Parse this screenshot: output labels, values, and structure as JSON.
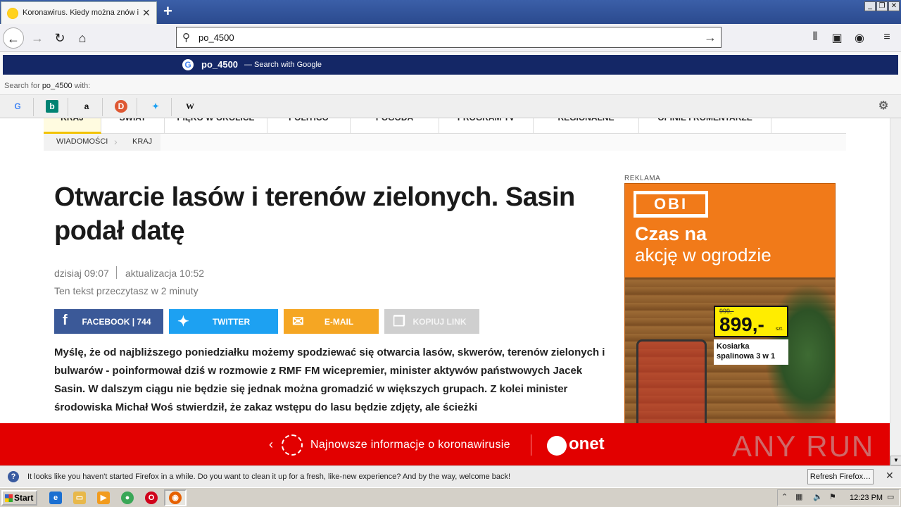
{
  "browser": {
    "tab_title": "Koronawirus. Kiedy można znów iść",
    "tab_close": "✕",
    "new_tab": "+",
    "window_buttons": [
      "_",
      "❐",
      "✕"
    ],
    "url": "po_4500",
    "suggestion": {
      "query": "po_4500",
      "hint": "— Search with Google",
      "search_for_prefix": "Search for",
      "search_for_query": "po_4500",
      "search_for_suffix": "with:"
    },
    "engines": [
      {
        "name": "google-icon",
        "glyph": "G",
        "color": "#4285f4"
      },
      {
        "name": "bing-icon",
        "glyph": "b",
        "color": "#008373"
      },
      {
        "name": "amazon-icon",
        "glyph": "a",
        "color": "#ff9900"
      },
      {
        "name": "duckduckgo-icon",
        "glyph": "●",
        "color": "#de5833"
      },
      {
        "name": "twitter-icon",
        "glyph": "🐦",
        "color": "#1da1f2"
      },
      {
        "name": "wikipedia-icon",
        "glyph": "W",
        "color": "#111111"
      }
    ]
  },
  "site": {
    "menu": [
      "KRAJ",
      "ŚWIAT",
      "PIĘKO W OKOLICE",
      "POLITICO",
      "POGODA",
      "PROGRAM TV",
      "REGIONALNE",
      "OPINIE I KOMENTARZE"
    ],
    "breadcrumb": [
      "WIADOMOŚCI",
      "KRAJ"
    ]
  },
  "article": {
    "headline": "Otwarcie lasów i terenów zielonych. Sasin podał datę",
    "date": "dzisiaj 09:07",
    "updated": "aktualizacja 10:52",
    "read_time": "Ten tekst przeczytasz w 2 minuty",
    "share": {
      "facebook": "FACEBOOK | 744",
      "twitter": "TWITTER",
      "email": "E-MAIL",
      "copy": "KOPIUJ LINK"
    },
    "body": "Myślę, że od najbliższego poniedziałku możemy spodziewać się otwarcia lasów, skwerów, terenów zielonych i bulwarów - poinformował dziś w rozmowie z RMF FM wicepremier, minister aktywów państwowych Jacek Sasin. W dalszym ciągu nie będzie się jednak można gromadzić w większych grupach. Z kolei minister środowiska Michał Woś stwierdził, że zakaz wstępu do lasu będzie zdjęty, ale ścieżki"
  },
  "ad": {
    "label": "REKLAMA",
    "logo": "OBI",
    "line1": "Czas na",
    "line2": "akcję w ogrodzie",
    "old_price": "999,-",
    "price": "899,-",
    "unit": "szt.",
    "product": "Kosiarka spalinowa 3 w 1"
  },
  "banner": {
    "text": "Najnowsze informacje o koronawirusie",
    "brand": "onet"
  },
  "watermark": "ANY RUN",
  "notification": {
    "text": "It looks like you haven't started Firefox in a while. Do you want to clean it up for a fresh, like-new experience? And by the way, welcome back!",
    "button": "Refresh Firefox…"
  },
  "taskbar": {
    "start": "Start",
    "clock": "12:23 PM"
  },
  "colors": {
    "facebook": "#3b5998",
    "twitter": "#1da1f2",
    "email": "#f5a623",
    "copy": "#cfcfcf",
    "banner": "#e20000",
    "obi_orange": "#f17a19"
  }
}
